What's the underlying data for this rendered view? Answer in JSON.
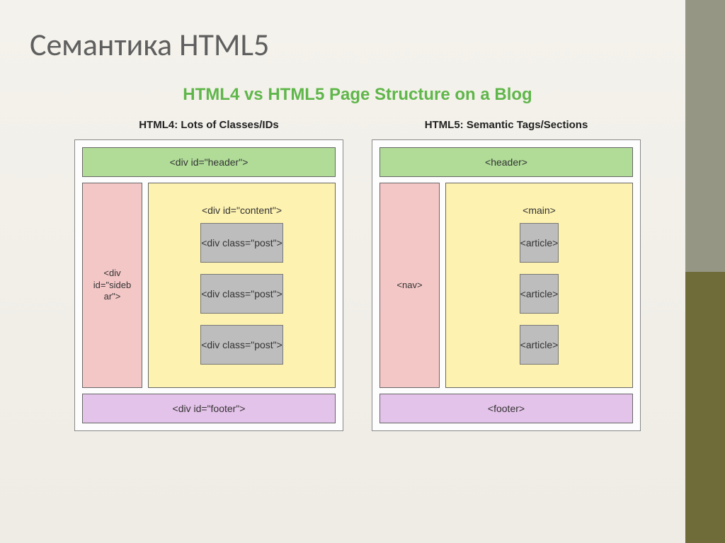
{
  "slide": {
    "title": "Семантика HTML5"
  },
  "comparison": {
    "title": "HTML4 vs HTML5 Page Structure on a Blog",
    "left": {
      "heading": "HTML4: Lots of Classes/IDs",
      "header": "<div id=\"header\">",
      "sidebar": "<div id=\"sideb ar\">",
      "content_label": "<div id=\"content\">",
      "posts": [
        "<div class=\"post\">",
        "<div class=\"post\">",
        "<div class=\"post\">"
      ],
      "footer": "<div id=\"footer\">"
    },
    "right": {
      "heading": "HTML5: Semantic Tags/Sections",
      "header": "<header>",
      "sidebar": "<nav>",
      "content_label": "<main>",
      "posts": [
        "<article>",
        "<article>",
        "<article>"
      ],
      "footer": "<footer>"
    }
  }
}
